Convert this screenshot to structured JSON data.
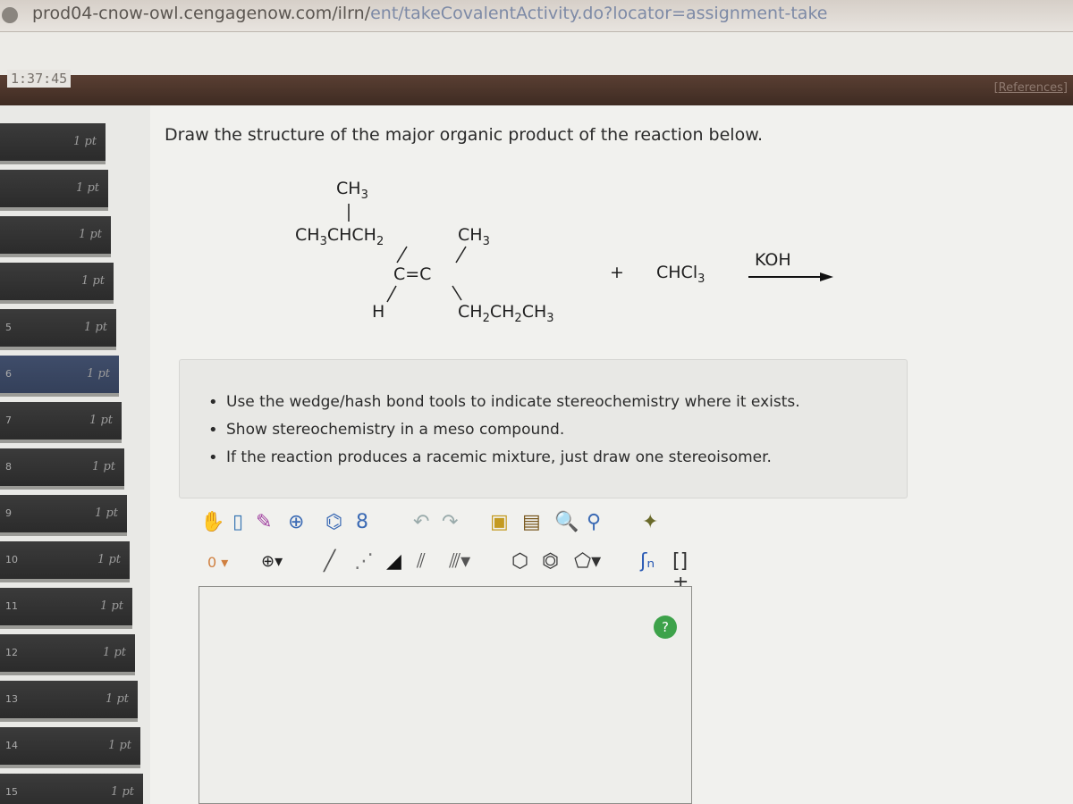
{
  "browser": {
    "url_host": "prod04-cnow-owl.cengagenow.com/ilrn/",
    "url_path": "ent/takeCovalentActivity.do?locator=assignment-take"
  },
  "header": {
    "timer": "1:37:45",
    "references_label": "[References]"
  },
  "sidebar": {
    "items": [
      {
        "num": "",
        "points": "1 pt"
      },
      {
        "num": "",
        "points": "1 pt"
      },
      {
        "num": "",
        "points": "1 pt"
      },
      {
        "num": "",
        "points": "1 pt"
      },
      {
        "num": "5",
        "points": "1 pt"
      },
      {
        "num": "6",
        "points": "1 pt"
      },
      {
        "num": "7",
        "points": "1 pt"
      },
      {
        "num": "8",
        "points": "1 pt"
      },
      {
        "num": "9",
        "points": "1 pt"
      },
      {
        "num": "10",
        "points": "1 pt"
      },
      {
        "num": "11",
        "points": "1 pt"
      },
      {
        "num": "12",
        "points": "1 pt"
      },
      {
        "num": "13",
        "points": "1 pt"
      },
      {
        "num": "14",
        "points": "1 pt"
      },
      {
        "num": "15",
        "points": "1 pt"
      }
    ]
  },
  "question": {
    "prompt": "Draw the structure of the major organic product of the reaction below.",
    "reactant": {
      "top_methyl": "CH3",
      "left_chain": "CH3CHCH2",
      "right_methyl": "CH3",
      "double_bond": "C=C",
      "hydrogen": "H",
      "right_chain": "CH2CH2CH3"
    },
    "plus": "+",
    "reagent": "CHCl3",
    "condition": "KOH"
  },
  "instructions": [
    "Use the wedge/hash bond tools to indicate stereochemistry where it exists.",
    "Show stereochemistry in a meso compound.",
    "If the reaction produces a racemic mixture, just draw one stereoisomer."
  ],
  "toolbar": {
    "charge_value": "0",
    "help_label": "?"
  }
}
